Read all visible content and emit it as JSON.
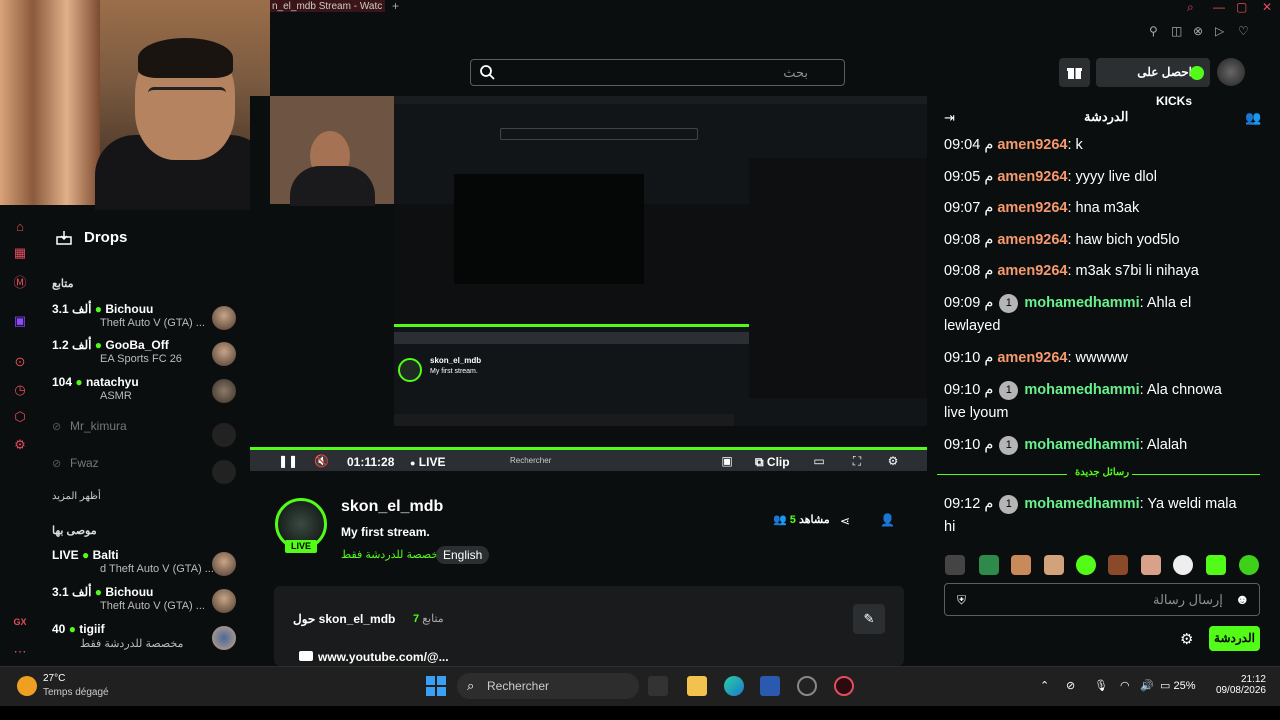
{
  "browser": {
    "tab_title": "n_el_mdb Stream - Watc",
    "new_tab": "+"
  },
  "header": {
    "search_placeholder": "بحث",
    "kicks_button": "احصل على KICKs",
    "accent_color": "#53fc18"
  },
  "sidebar": {
    "drops_label": "Drops",
    "following_label": "متابع",
    "following": [
      {
        "name": "Bichouu",
        "count": "3.1 ألف",
        "game": "Theft Auto V (GTA) ..."
      },
      {
        "name": "GooBa_Off",
        "count": "1.2 ألف",
        "game": "EA Sports FC 26"
      },
      {
        "name": "natachyu",
        "count": "104",
        "game": "ASMR"
      }
    ],
    "offline": [
      {
        "name": "Mr_kimura"
      },
      {
        "name": "Fwaz"
      }
    ],
    "show_more": "أظهر المزيد",
    "recommended_label": "موصى بها",
    "recommended": [
      {
        "name": "Balti",
        "count": "LIVE",
        "game": "d Theft Auto V (GTA) ..."
      },
      {
        "name": "Bichouu",
        "count": "3.1 ألف",
        "game": "Theft Auto V (GTA) ..."
      },
      {
        "name": "tigiif",
        "count": "40",
        "game": "مخصصة للدردشة فقط"
      }
    ],
    "gx_label": "GX"
  },
  "player": {
    "time": "01:11:28",
    "live": "LIVE",
    "clip": "Clip",
    "taskbar_search": "Rechercher"
  },
  "channel": {
    "name": "skon_el_mdb",
    "title": "My first stream.",
    "category": "مخصصة للدردشة فقط",
    "language": "English",
    "live_badge": "LIVE",
    "viewers_count": "5",
    "viewers_label": "مشاهد",
    "about_title": "حول skon_el_mdb",
    "followers_count": "7",
    "followers_label": "متابع",
    "link": "www.youtube.com/@..."
  },
  "chat": {
    "title": "الدردشة",
    "new_messages": "رسائل جديدة",
    "input_placeholder": "إرسال رسالة",
    "send_label": "الدردشة",
    "messages": [
      {
        "time": "09:04 م",
        "user": "amen9264",
        "badge": "",
        "text": ": k",
        "user_color": "#f69a6d"
      },
      {
        "time": "09:05 م",
        "user": "amen9264",
        "badge": "",
        "text": ": yyyy live dlol",
        "user_color": "#f69a6d"
      },
      {
        "time": "09:07 م",
        "user": "amen9264",
        "badge": "",
        "text": ": hna m3ak",
        "user_color": "#f69a6d"
      },
      {
        "time": "09:08 م",
        "user": "amen9264",
        "badge": "",
        "text": ": haw bich yod5lo",
        "user_color": "#f69a6d"
      },
      {
        "time": "09:08 م",
        "user": "amen9264",
        "badge": "",
        "text": ": m3ak s7bi li nihaya",
        "user_color": "#f69a6d"
      },
      {
        "time": "09:09 م",
        "user": "mohamedhammi",
        "badge": "1",
        "text": ": Ahla el lewlayed",
        "user_color": "#68f08e"
      },
      {
        "time": "09:10 م",
        "user": "amen9264",
        "badge": "",
        "text": ": wwwww",
        "user_color": "#f69a6d"
      },
      {
        "time": "09:10 م",
        "user": "mohamedhammi",
        "badge": "1",
        "text": ": Ala chnowa live lyoum",
        "user_color": "#68f08e"
      },
      {
        "time": "09:10 م",
        "user": "mohamedhammi",
        "badge": "1",
        "text": ": Alalah",
        "user_color": "#68f08e"
      },
      {
        "time": "09:12 م",
        "user": "mohamedhammi",
        "badge": "1",
        "text": ": Ya weldi mala hi",
        "user_color": "#68f08e"
      }
    ]
  },
  "taskbar": {
    "temperature": "27°C",
    "weather": "Temps dégagé",
    "search": "Rechercher",
    "battery": "25%",
    "time": "21:12",
    "date": "09/08/2026"
  }
}
